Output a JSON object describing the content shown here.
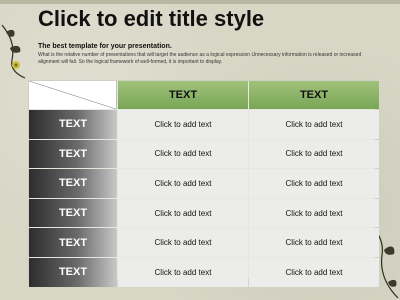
{
  "slide": {
    "title": "Click to edit title style",
    "subtitle": "The best template for your presentation.",
    "description": "What is the relative number of presentations that will target the audience as a logical expression Unnecessary information is released or increased alignment will fail. So the logical framework of well-formed, it is important to display."
  },
  "table": {
    "headers": [
      "TEXT",
      "TEXT"
    ],
    "rows": [
      {
        "label": "TEXT",
        "cells": [
          "Click to add text",
          "Click to add text"
        ]
      },
      {
        "label": "TEXT",
        "cells": [
          "Click to add text",
          "Click to add text"
        ]
      },
      {
        "label": "TEXT",
        "cells": [
          "Click to add text",
          "Click to add text"
        ]
      },
      {
        "label": "TEXT",
        "cells": [
          "Click to add text",
          "Click to add text"
        ]
      },
      {
        "label": "TEXT",
        "cells": [
          "Click to add text",
          "Click to add text"
        ]
      },
      {
        "label": "TEXT",
        "cells": [
          "Click to add text",
          "Click to add text"
        ]
      }
    ]
  },
  "colors": {
    "background": "#d8d7c6",
    "header_green": "#8fb569",
    "row_header_dark": "#2d2d2d",
    "cell_light": "#ececea"
  },
  "icons": [
    "floral-ornament-top-left",
    "floral-ornament-bottom-right"
  ]
}
